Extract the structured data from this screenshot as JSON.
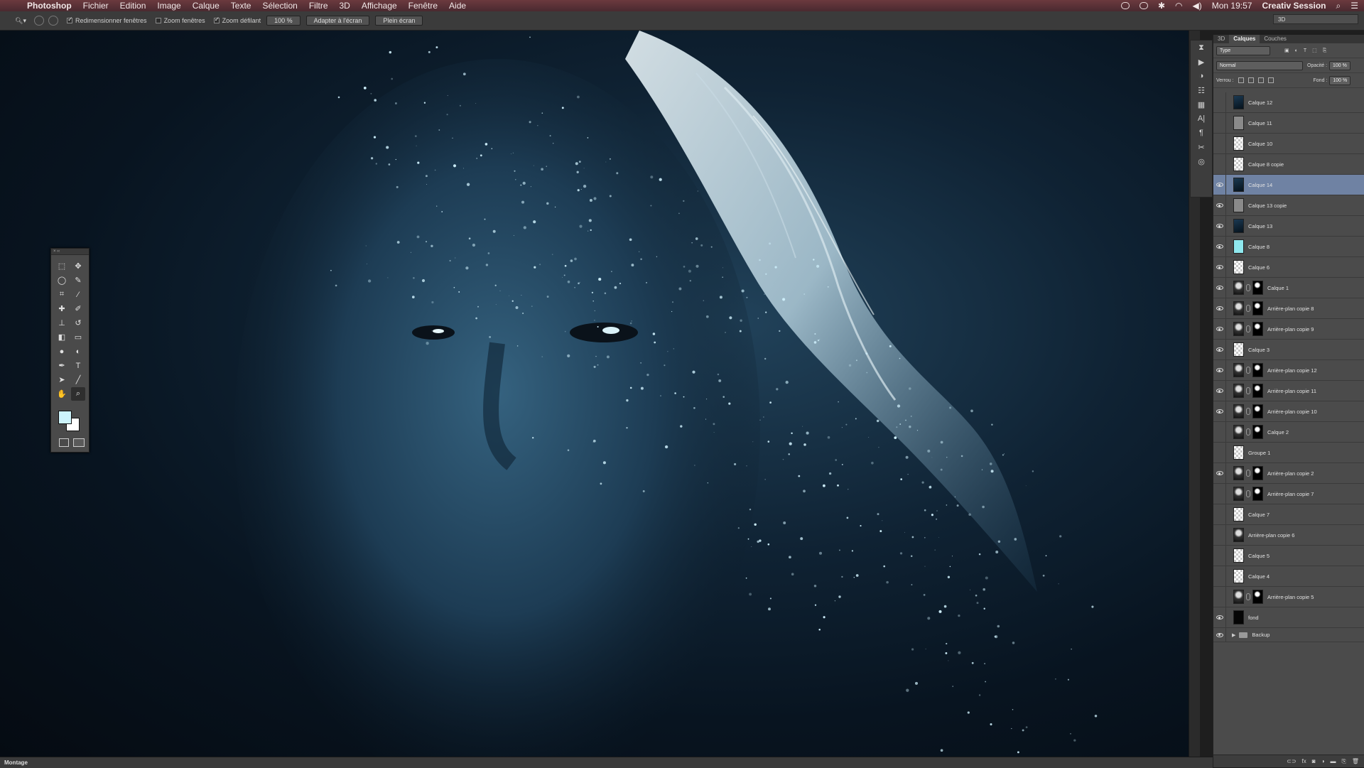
{
  "menubar": {
    "app": "Photoshop",
    "items": [
      "Fichier",
      "Edition",
      "Image",
      "Calque",
      "Texte",
      "Sélection",
      "Filtre",
      "3D",
      "Affichage",
      "Fenêtre",
      "Aide"
    ],
    "clock": "Mon 19:57",
    "session": "Creativ Session"
  },
  "options": {
    "resize_windows": "Redimensionner fenêtres",
    "zoom_windows": "Zoom fenêtres",
    "scrubby_zoom": "Zoom défilant",
    "zoom_value": "100 %",
    "fit_screen": "Adapter à l'écran",
    "fill_screen": "Plein écran",
    "workspace": "3D"
  },
  "statusbar": {
    "label": "Montage"
  },
  "layers_panel": {
    "tabs": [
      "3D",
      "Calques",
      "Couches"
    ],
    "active_tab": "Calques",
    "filter": "Type",
    "blend_mode": "Normal",
    "opacity_label": "Opacité :",
    "opacity_value": "100 %",
    "lock_label": "Verrou :",
    "fill_label": "Fond :",
    "fill_value": "100 %",
    "layers": [
      {
        "name": "Calque 12",
        "visible": false,
        "thumb": "dark",
        "mask": false,
        "selected": false
      },
      {
        "name": "Calque 11",
        "visible": false,
        "thumb": "gray",
        "mask": false,
        "selected": false
      },
      {
        "name": "Calque 10",
        "visible": false,
        "thumb": "checker",
        "mask": false,
        "selected": false
      },
      {
        "name": "Calque 8 copie",
        "visible": false,
        "thumb": "checker",
        "mask": false,
        "selected": false
      },
      {
        "name": "Calque 14",
        "visible": true,
        "thumb": "dark",
        "mask": false,
        "selected": true
      },
      {
        "name": "Calque 13 copie",
        "visible": true,
        "thumb": "gray",
        "mask": false,
        "selected": false
      },
      {
        "name": "Calque 13",
        "visible": true,
        "thumb": "dark",
        "mask": false,
        "selected": false
      },
      {
        "name": "Calque 8",
        "visible": true,
        "thumb": "cyan",
        "mask": false,
        "selected": false
      },
      {
        "name": "Calque 6",
        "visible": true,
        "thumb": "checker",
        "mask": false,
        "selected": false
      },
      {
        "name": "Calque 1",
        "visible": true,
        "thumb": "photo",
        "mask": true,
        "selected": false
      },
      {
        "name": "Arrière-plan copie 8",
        "visible": true,
        "thumb": "photo",
        "mask": true,
        "selected": false
      },
      {
        "name": "Arrière-plan copie 9",
        "visible": true,
        "thumb": "photo",
        "mask": true,
        "selected": false
      },
      {
        "name": "Calque 3",
        "visible": true,
        "thumb": "checker",
        "mask": false,
        "selected": false
      },
      {
        "name": "Arrière-plan copie 12",
        "visible": true,
        "thumb": "photo",
        "mask": true,
        "selected": false
      },
      {
        "name": "Arrière-plan copie 11",
        "visible": true,
        "thumb": "photo",
        "mask": true,
        "selected": false
      },
      {
        "name": "Arrière-plan copie 10",
        "visible": true,
        "thumb": "photo",
        "mask": true,
        "selected": false
      },
      {
        "name": "Calque 2",
        "visible": false,
        "thumb": "photo",
        "mask": true,
        "selected": false
      },
      {
        "name": "Groupe 1",
        "visible": false,
        "thumb": "checker",
        "mask": false,
        "selected": false
      },
      {
        "name": "Arrière-plan copie 2",
        "visible": true,
        "thumb": "photo",
        "mask": true,
        "selected": false
      },
      {
        "name": "Arrière-plan copie 7",
        "visible": false,
        "thumb": "photo",
        "mask": true,
        "selected": false
      },
      {
        "name": "Calque 7",
        "visible": false,
        "thumb": "checker",
        "mask": false,
        "selected": false
      },
      {
        "name": "Arrière-plan copie 6",
        "visible": false,
        "thumb": "photo",
        "mask": false,
        "selected": false
      },
      {
        "name": "Calque 5",
        "visible": false,
        "thumb": "checker",
        "mask": false,
        "selected": false
      },
      {
        "name": "Calque 4",
        "visible": false,
        "thumb": "checker",
        "mask": false,
        "selected": false
      },
      {
        "name": "Arrière-plan copie 5",
        "visible": false,
        "thumb": "photo",
        "mask": true,
        "selected": false
      },
      {
        "name": "fond",
        "visible": true,
        "thumb": "black",
        "mask": false,
        "selected": false
      }
    ],
    "folder": {
      "name": "Backup",
      "visible": true
    }
  },
  "colors": {
    "foreground": "#cdf3fb",
    "background": "#ffffff",
    "selected_layer": "#6f82a3"
  }
}
